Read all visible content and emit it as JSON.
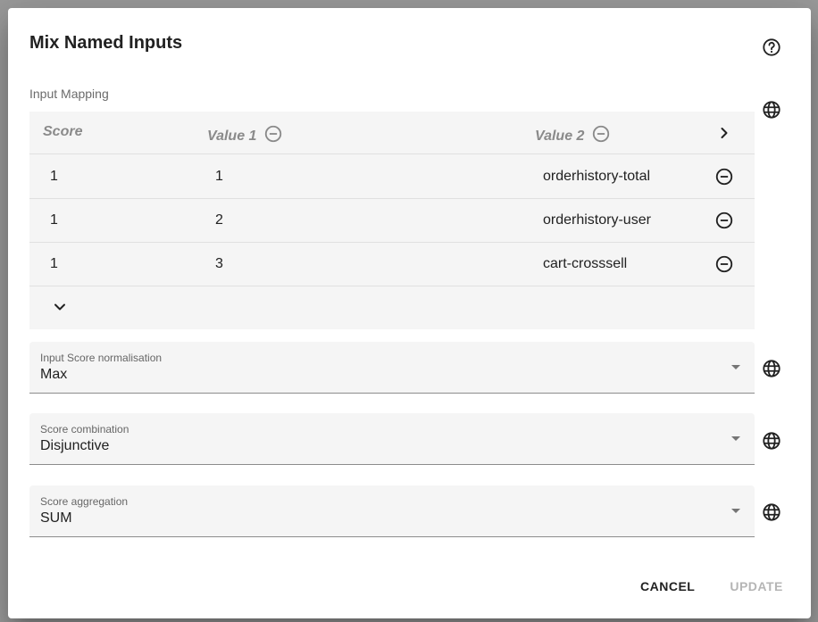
{
  "dialog": {
    "title": "Mix Named Inputs",
    "help_icon": "help-circle-icon"
  },
  "mapping": {
    "label": "Input Mapping",
    "columns": [
      "Score",
      "Value 1",
      "Value 2"
    ],
    "rows": [
      {
        "score": "1",
        "value1": "1",
        "value2": "orderhistory-total"
      },
      {
        "score": "1",
        "value1": "2",
        "value2": "orderhistory-user"
      },
      {
        "score": "1",
        "value1": "3",
        "value2": "cart-crosssell"
      }
    ]
  },
  "fields": {
    "normalisation": {
      "label": "Input Score normalisation",
      "value": "Max"
    },
    "combination": {
      "label": "Score combination",
      "value": "Disjunctive"
    },
    "aggregation": {
      "label": "Score aggregation",
      "value": "SUM"
    }
  },
  "actions": {
    "cancel": "CANCEL",
    "update": "UPDATE"
  },
  "colors": {
    "text": "#212121",
    "muted": "#8a8a8a",
    "disabled": "#b5b5b5",
    "field_bg": "#f5f5f5"
  }
}
